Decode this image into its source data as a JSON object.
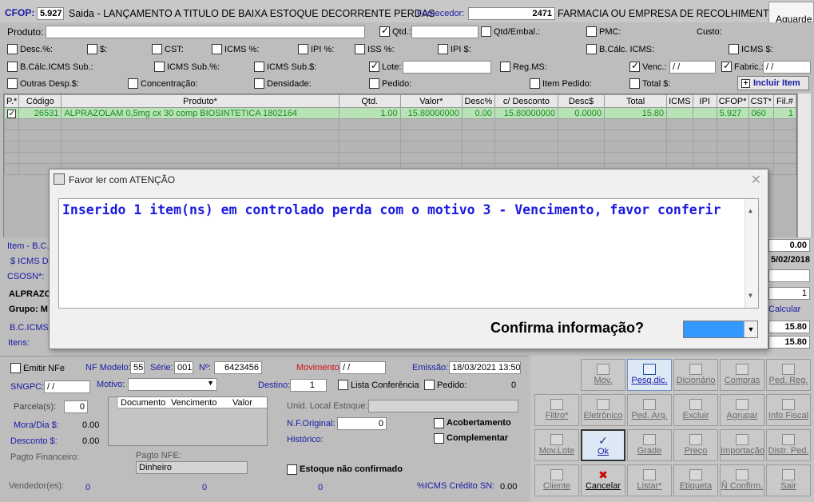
{
  "header": {
    "cfop_label": "CFOP:",
    "cfop_value": "5.927",
    "operation": "Saida - LANÇAMENTO A TITULO DE BAIXA ESTOQUE DECORRENTE  PERDAS",
    "fornecedor_label": "Fornecedor:",
    "fornecedor_value": "2471",
    "fornecedor_name": "FARMACIA OU EMPRESA DE RECOLHIMENTO",
    "wait_label": "Aguarde, "
  },
  "form": {
    "produto": "Produto:",
    "qtd": "Qtd.:",
    "qtd_embal": "Qtd/Embal.:",
    "pmc": "PMC:",
    "custo": "Custo:",
    "desc_pct": "Desc.%:",
    "dollar": "$:",
    "cst": "CST:",
    "icms_pct": "ICMS %:",
    "ipi_pct": "IPI %:",
    "iss_pct": "ISS %:",
    "ipi_val": "IPI $:",
    "bc_icms": "B.Cálc. ICMS:",
    "icms_val": "ICMS $:",
    "bc_icms_sub": "B.Cálc.ICMS Sub.:",
    "icms_sub_pct": "ICMS Sub.%:",
    "icms_sub_val": "ICMS Sub.$:",
    "lote": "Lote:",
    "reg_ms": "Reg.MS:",
    "venc": "Venc.:",
    "venc_val": "/ /",
    "fabric": "Fabric.:",
    "fabric_val": "/ /",
    "outras_desp": "Outras Desp.$:",
    "concentracao": "Concentração:",
    "densidade": "Densidade:",
    "pedido": "Pedido:",
    "item_pedido": "Item Pedido:",
    "total": "Total $:",
    "incluir": "Incluir Item"
  },
  "grid": {
    "headers": [
      "P.*",
      "Código",
      "Produto*",
      "Qtd.",
      "Valor*",
      "Desc%",
      "c/ Desconto",
      "Desc$",
      "Total",
      "ICMS",
      "IPI",
      "CFOP*",
      "CST*",
      "Fil.#"
    ],
    "row": [
      "26531",
      "ALPRAZOLAM 0,5mg cx 30 comp  BIOSINTETICA 1802164",
      "1.00",
      "15.80000000",
      "0.00",
      "15.80000000",
      "0.0000",
      "15.80",
      "",
      "",
      "5.927",
      "060",
      "1"
    ]
  },
  "side": {
    "item_bc": "Item - B.C.I",
    "icms_de": "$ ICMS De",
    "csosn": "CSOSN*:",
    "alprazo": "ALPRAZO",
    "grupo": "Grupo: M",
    "bc_icms": "B.C.ICMS:",
    "itens": "Itens:",
    "val1": "0.00",
    "date": "5/02/2018",
    "spin": "1",
    "calcular": "Calcular",
    "val2": "15.80",
    "val3": "15.80"
  },
  "dialog": {
    "title": "Favor ler com ATENÇÃO",
    "message": "Inserido 1 item(ns) em controlado perda com o motivo 3 - Vencimento, favor conferir",
    "confirm": "Confirma informação?"
  },
  "bottom": {
    "emitir": "Emitir NFe",
    "nf_modelo": "NF Modelo:",
    "nf_modelo_val": "55",
    "serie": "Série:",
    "serie_val": "001",
    "numero": "Nº:",
    "numero_val": "6423456",
    "movimento": "Movimento",
    "movimento_val": "/ /",
    "emissao": "Emissão:",
    "emissao_val": "18/03/2021 13:50",
    "sngpc": "SNGPC:",
    "sngpc_val": "/ /",
    "motivo": "Motivo:",
    "destino": "Destino:",
    "destino_val": "1",
    "lista": "Lista Conferência",
    "pedido": "Pedido:",
    "pedido_val": "0",
    "parcelas": "Parcela(s):",
    "parcelas_val": "0",
    "doc_headers": [
      "Documento",
      "Vencimento",
      "Valor"
    ],
    "unid": "Unid. Local Estoque:",
    "mora": "Mora/Dia $:",
    "mora_val": "0.00",
    "nf_original": "N.F.Original:",
    "nf_original_val": "0",
    "acobertamento": "Acobertamento",
    "desconto": "Desconto $:",
    "desconto_val": "0.00",
    "historico": "Histórico:",
    "complementar": "Complementar",
    "pagto_fin": "Pagto Financeiro:",
    "pagto_nfe": "Pagto NFE:",
    "pagto_nfe_val": "Dinheiro",
    "estoque": "Estoque não confirmado",
    "vendedor": "Vendedor(es):",
    "v1": "0",
    "v2": "0",
    "v3": "0",
    "icms_credito": "%ICMS Crédito SN:",
    "icms_credito_val": "0.00"
  },
  "buttons": [
    [
      "Mov.",
      "Pesq.dic.",
      "Dicionário",
      "Compras",
      "Ped. Reg."
    ],
    [
      "Filtro*",
      "Eletrônico",
      "Ped. Arq.",
      "Excluir",
      "Agrupar",
      "Info Fiscal"
    ],
    [
      "Mov.Lote",
      "Ok",
      "Grade",
      "Preço",
      "Importação",
      "Distr. Ped."
    ],
    [
      "Cliente",
      "Cancelar",
      "Listar*",
      "Etiqueta",
      "Ñ Confirm.",
      "Sair"
    ]
  ]
}
